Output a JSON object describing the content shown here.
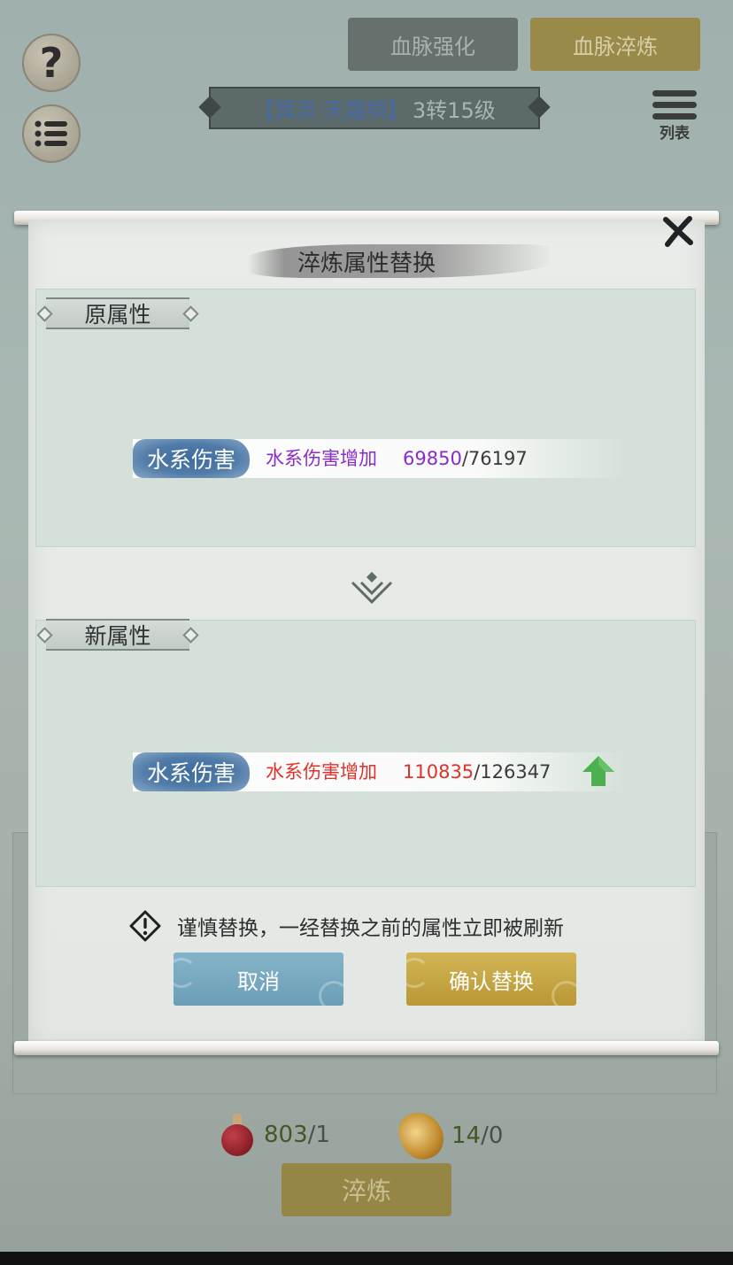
{
  "top_tabs": {
    "strengthen": "血脉强化",
    "refine": "血脉淬炼"
  },
  "header": {
    "level_name": "【冥灵·天霜鸮】",
    "level_text": "3转15级",
    "list_label": "列表"
  },
  "side_buttons": {
    "help_glyph": "?"
  },
  "modal": {
    "title": "淬炼属性替换",
    "close_icon": "close-icon",
    "old_section": {
      "label": "原属性",
      "attr_badge": "水系伤害",
      "attr_desc": "水系伤害增加",
      "attr_current": "69850",
      "attr_max": "/76197",
      "color": "#8a2cc8"
    },
    "new_section": {
      "label": "新属性",
      "attr_badge": "水系伤害",
      "attr_desc": "水系伤害增加",
      "attr_current": "110835",
      "attr_max": "/126347",
      "color": "#e0322a",
      "trend_icon": "up-arrow-icon"
    },
    "warning_text": "谨慎替换，一经替换之前的属性立即被刷新",
    "cancel_label": "取消",
    "confirm_label": "确认替换"
  },
  "resources": {
    "potion": {
      "have": "803",
      "need": "/1",
      "icon": "potion-icon"
    },
    "stone": {
      "have": "14",
      "need": "/0",
      "icon": "stone-icon"
    }
  },
  "refine_button": "淬炼",
  "colors": {
    "accent_gold": "#b99835",
    "accent_blue": "#6b9eb6",
    "increase_green": "#4caf50"
  }
}
